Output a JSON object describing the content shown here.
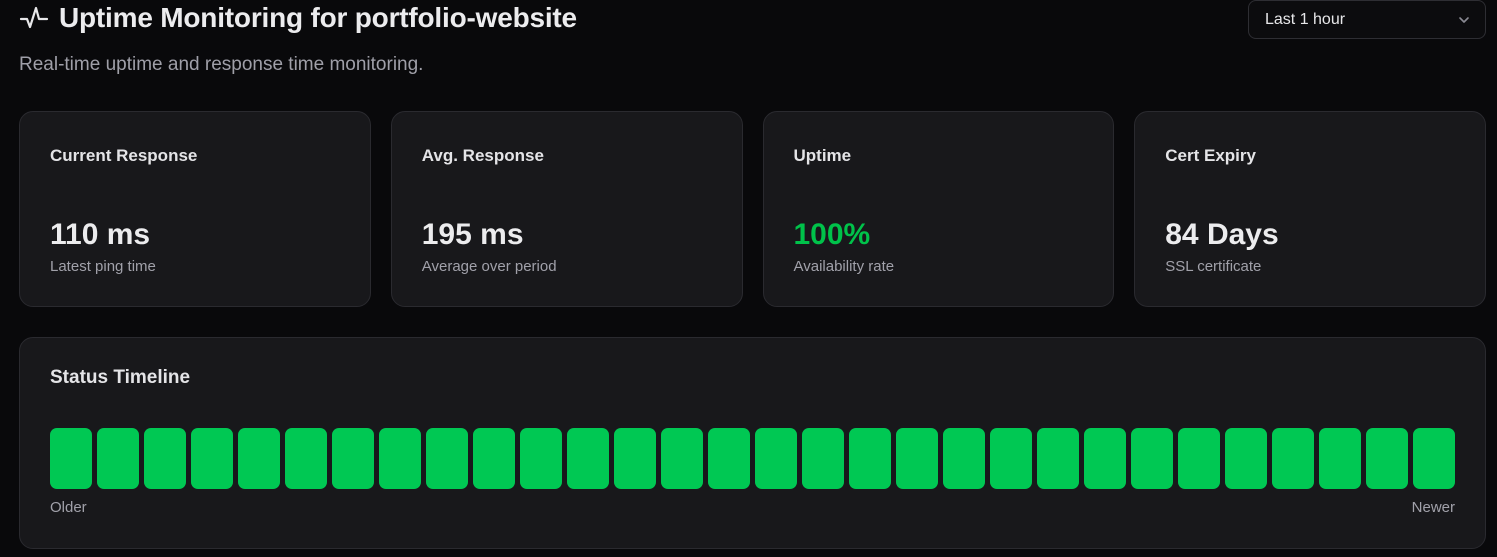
{
  "header": {
    "title": "Uptime Monitoring for portfolio-website",
    "subtitle": "Real-time uptime and response time monitoring.",
    "icon": "activity-pulse-icon",
    "range_select": {
      "selected": "Last 1 hour",
      "icon": "chevron-down-icon"
    }
  },
  "cards": [
    {
      "label": "Current Response",
      "value": "110 ms",
      "caption": "Latest ping time"
    },
    {
      "label": "Avg. Response",
      "value": "195 ms",
      "caption": "Average over period"
    },
    {
      "label": "Uptime",
      "value": "100%",
      "caption": "Availability rate",
      "value_color": "#00c24a"
    },
    {
      "label": "Cert Expiry",
      "value": "84 Days",
      "caption": "SSL certificate"
    }
  ],
  "timeline": {
    "title": "Status Timeline",
    "older_label": "Older",
    "newer_label": "Newer",
    "up_color": "#00c853",
    "bars": [
      "up",
      "up",
      "up",
      "up",
      "up",
      "up",
      "up",
      "up",
      "up",
      "up",
      "up",
      "up",
      "up",
      "up",
      "up",
      "up",
      "up",
      "up",
      "up",
      "up",
      "up",
      "up",
      "up",
      "up",
      "up",
      "up",
      "up",
      "up",
      "up",
      "up"
    ]
  },
  "colors": {
    "background": "#09090b",
    "card": "#18181b",
    "accent_green": "#00c24a"
  }
}
